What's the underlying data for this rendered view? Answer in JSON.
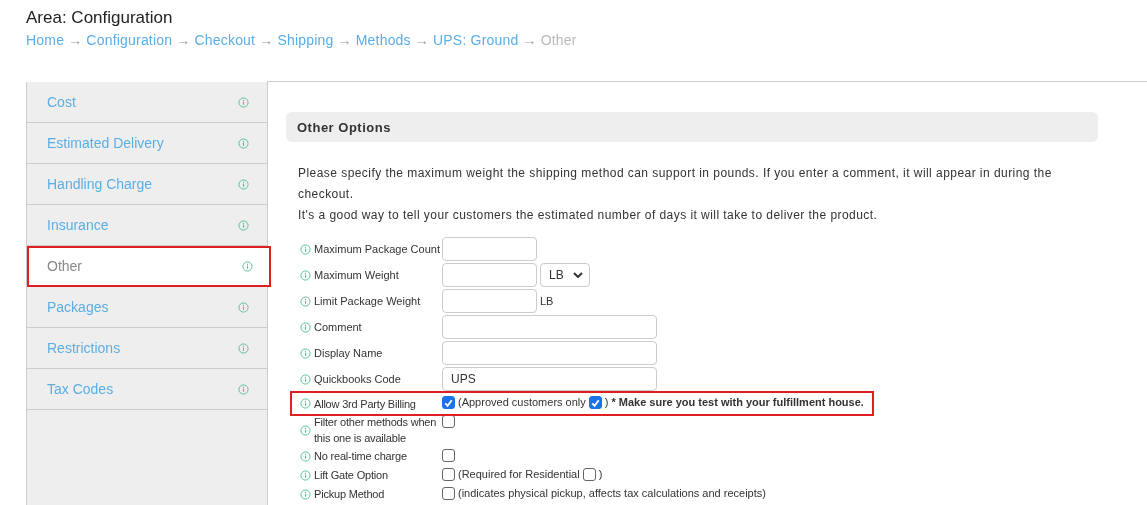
{
  "header": {
    "title": "Area: Configuration"
  },
  "breadcrumbs": [
    {
      "label": "Home",
      "current": false
    },
    {
      "label": "Configuration",
      "current": false
    },
    {
      "label": "Checkout",
      "current": false
    },
    {
      "label": "Shipping",
      "current": false
    },
    {
      "label": "Methods",
      "current": false
    },
    {
      "label": "UPS: Ground",
      "current": false
    },
    {
      "label": "Other",
      "current": true
    }
  ],
  "breadcrumb_separator": "→",
  "sidebar": {
    "items": [
      {
        "label": "Cost",
        "selected": false,
        "highlighted": false
      },
      {
        "label": "Estimated Delivery",
        "selected": false,
        "highlighted": false
      },
      {
        "label": "Handling Charge",
        "selected": false,
        "highlighted": false
      },
      {
        "label": "Insurance",
        "selected": false,
        "highlighted": false
      },
      {
        "label": "Other",
        "selected": true,
        "highlighted": true
      },
      {
        "label": "Packages",
        "selected": false,
        "highlighted": false
      },
      {
        "label": "Restrictions",
        "selected": false,
        "highlighted": false
      },
      {
        "label": "Tax Codes",
        "selected": false,
        "highlighted": false
      }
    ]
  },
  "section": {
    "title": "Other Options",
    "description": [
      "Please specify the maximum weight the shipping method can support in pounds. If you enter a comment, it will appear in during the checkout.",
      "It's a good way to tell your customers the estimated number of days it will take to deliver the product."
    ],
    "rows": [
      {
        "label": "Maximum Package Count",
        "highlighted": false,
        "parts": [
          {
            "kind": "input",
            "wide": false
          }
        ]
      },
      {
        "label": "Maximum Weight",
        "highlighted": false,
        "parts": [
          {
            "kind": "input",
            "wide": false
          },
          {
            "kind": "select",
            "value": "LB"
          }
        ]
      },
      {
        "label": "Limit Package Weight",
        "highlighted": false,
        "parts": [
          {
            "kind": "input",
            "wide": false
          },
          {
            "kind": "text",
            "text": "LB",
            "bold": false
          }
        ]
      },
      {
        "label": "Comment",
        "highlighted": false,
        "parts": [
          {
            "kind": "input",
            "wide": true
          }
        ]
      },
      {
        "label": "Display Name",
        "highlighted": false,
        "parts": [
          {
            "kind": "input",
            "wide": true
          }
        ]
      },
      {
        "label": "Quickbooks Code",
        "highlighted": false,
        "parts": [
          {
            "kind": "input",
            "wide": true,
            "value": "UPS"
          }
        ]
      },
      {
        "label": "Allow 3rd Party Billing",
        "highlighted": true,
        "parts": [
          {
            "kind": "checkbox",
            "checked": true
          },
          {
            "kind": "text",
            "text": "(Approved customers only",
            "bold": false
          },
          {
            "kind": "checkbox",
            "checked": true
          },
          {
            "kind": "text",
            "text": ")",
            "bold": false
          },
          {
            "kind": "text",
            "text": "* Make sure you test with your fulfillment house.",
            "bold": true
          }
        ]
      },
      {
        "label": "Filter other methods when this one is available",
        "highlighted": false,
        "parts": [
          {
            "kind": "checkbox",
            "checked": false
          }
        ]
      },
      {
        "label": "No real-time charge",
        "highlighted": false,
        "parts": [
          {
            "kind": "checkbox",
            "checked": false
          }
        ]
      },
      {
        "label": "Lift Gate Option",
        "highlighted": false,
        "parts": [
          {
            "kind": "checkbox",
            "checked": false
          },
          {
            "kind": "text",
            "text": "(Required for Residential",
            "bold": false
          },
          {
            "kind": "checkbox",
            "checked": false
          },
          {
            "kind": "text",
            "text": ")",
            "bold": false
          }
        ]
      },
      {
        "label": "Pickup Method",
        "highlighted": false,
        "parts": [
          {
            "kind": "checkbox",
            "checked": false
          },
          {
            "kind": "text",
            "text": "(indicates physical pickup, affects tax calculations and receipts)",
            "bold": false
          }
        ]
      }
    ]
  }
}
